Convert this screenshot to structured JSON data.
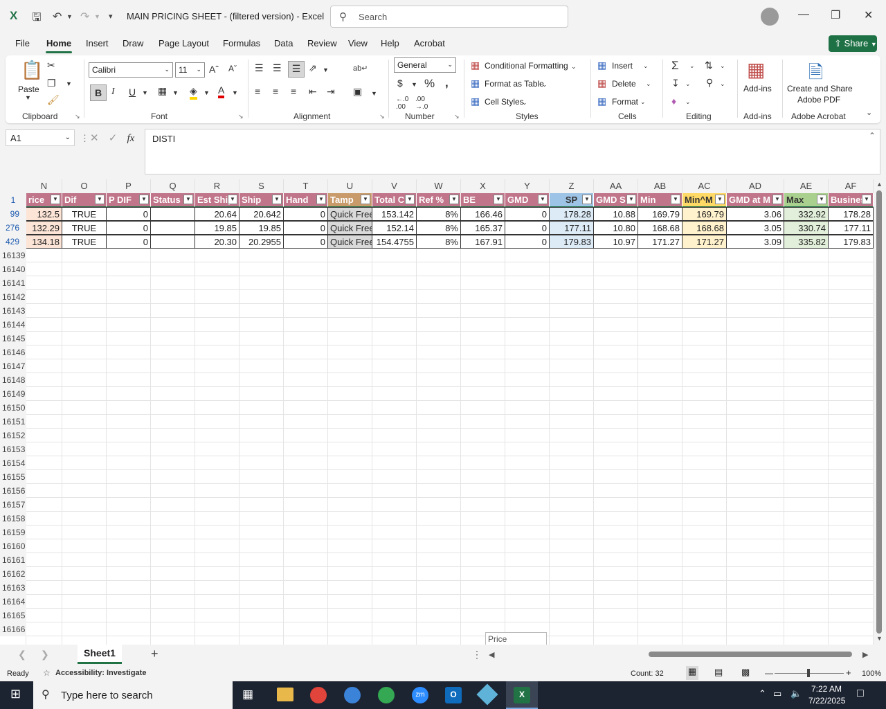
{
  "titlebar": {
    "doc_title": "MAIN PRICING SHEET - (filtered version)  -  Excel",
    "search_placeholder": "Search"
  },
  "menu": [
    "File",
    "Home",
    "Insert",
    "Draw",
    "Page Layout",
    "Formulas",
    "Data",
    "Review",
    "View",
    "Help",
    "Acrobat"
  ],
  "share_label": "Share",
  "ribbon": {
    "paste": "Paste",
    "clipboard": "Clipboard",
    "font_name": "Calibri",
    "font_size": "11",
    "font": "Font",
    "alignment": "Alignment",
    "number_format": "General",
    "number": "Number",
    "conditional_formatting": "Conditional Formatting",
    "format_as_table": "Format as Table",
    "cell_styles": "Cell Styles",
    "styles": "Styles",
    "insert": "Insert",
    "delete": "Delete",
    "format": "Format",
    "cells": "Cells",
    "editing": "Editing",
    "addins_btn": "Add-ins",
    "addins": "Add-ins",
    "create_share": "Create and Share",
    "adobe_pdf": "Adobe PDF",
    "adobe_acrobat": "Adobe Acrobat"
  },
  "formula_bar": {
    "name_box": "A1",
    "formula": "DISTI"
  },
  "columns": [
    "N",
    "O",
    "P",
    "Q",
    "R",
    "S",
    "T",
    "U",
    "V",
    "W",
    "X",
    "Y",
    "Z",
    "AA",
    "AB",
    "AC",
    "AD",
    "AE",
    "AF"
  ],
  "headers": [
    "rice",
    "Dif",
    "P DIF",
    "Status",
    "Est Ship",
    "Ship",
    "Hand",
    "Tamp",
    "Total C",
    "Ref %",
    "BE",
    "GMD",
    "SP",
    "GMD S",
    "Min",
    "Min^M",
    "GMD at M",
    "Max",
    "Busines"
  ],
  "header_row_number": "1",
  "data_rows": [
    {
      "row": "99",
      "cells": [
        "132.5",
        "TRUE",
        "0",
        "",
        "20.64",
        "20.642",
        "0",
        "Quick Free",
        "153.142",
        "8%",
        "166.46",
        "0",
        "178.28",
        "10.88",
        "169.79",
        "169.79",
        "3.06",
        "332.92",
        "178.28"
      ]
    },
    {
      "row": "276",
      "cells": [
        "132.29",
        "TRUE",
        "0",
        "",
        "19.85",
        "19.85",
        "0",
        "Quick Free",
        "152.14",
        "8%",
        "165.37",
        "0",
        "177.11",
        "10.80",
        "168.68",
        "168.68",
        "3.05",
        "330.74",
        "177.11"
      ]
    },
    {
      "row": "429",
      "cells": [
        "134.18",
        "TRUE",
        "0",
        "",
        "20.30",
        "20.2955",
        "0",
        "Quick Free",
        "154.4755",
        "8%",
        "167.91",
        "0",
        "179.83",
        "10.97",
        "171.27",
        "171.27",
        "3.09",
        "335.82",
        "179.83"
      ]
    }
  ],
  "empty_rows": [
    "16139",
    "16140",
    "16141",
    "16142",
    "16143",
    "16144",
    "16145",
    "16146",
    "16147",
    "16148",
    "16149",
    "16150",
    "16151",
    "16152",
    "16153",
    "16154",
    "16155",
    "16156",
    "16157",
    "16158",
    "16159",
    "16160",
    "16161",
    "16162",
    "16163",
    "16164",
    "16165",
    "16166"
  ],
  "tooltip": "Price",
  "sheet_tab": "Sheet1",
  "status": {
    "ready": "Ready",
    "accessibility": "Accessibility: Investigate",
    "count": "Count: 32",
    "zoom": "100%"
  },
  "taskbar": {
    "search_placeholder": "Type here to search",
    "time": "7:22 AM",
    "date": "7/22/2025"
  },
  "colors": {
    "accent": "#217346",
    "header_pink": "#c0758a",
    "header_tan": "#c99b6b",
    "header_blue": "#9dc3e6",
    "header_yellow": "#ffd966",
    "header_green": "#a9d08e",
    "sp_fill": "#ddebf7",
    "min_fill": "#fff2cc",
    "max_fill": "#e2efda",
    "price_fill": "#fce4d6"
  }
}
